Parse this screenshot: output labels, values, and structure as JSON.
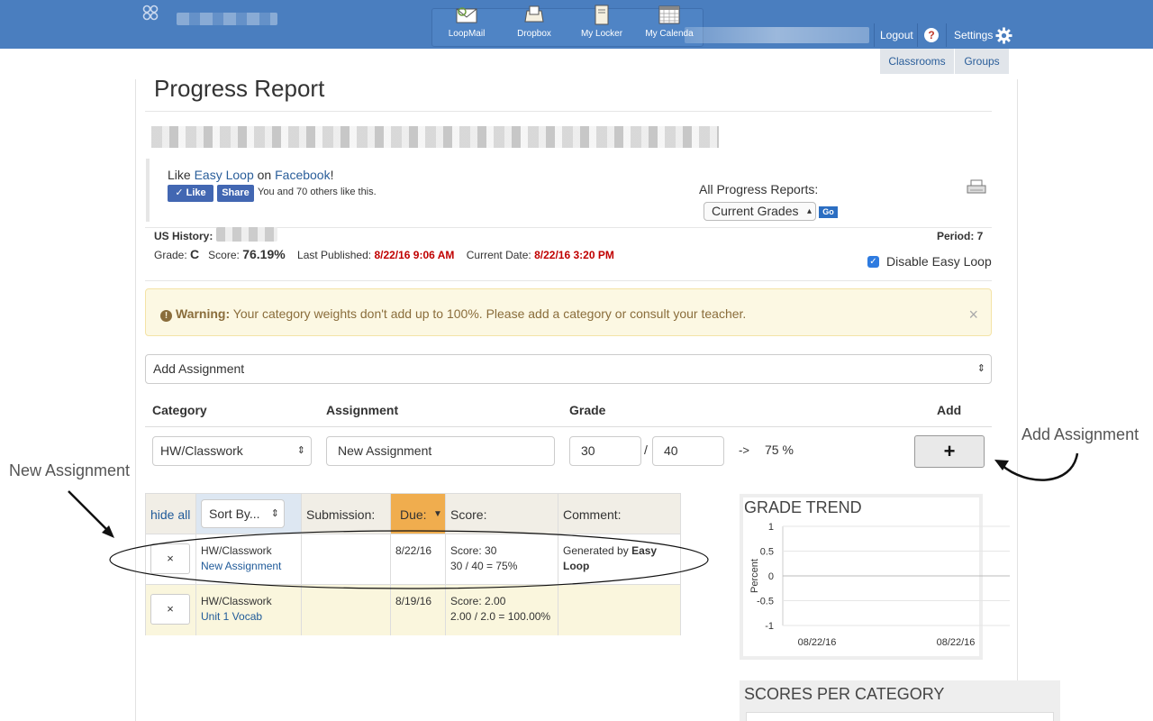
{
  "header": {
    "nav": [
      {
        "label": "LoopMail",
        "icon": "mail-icon"
      },
      {
        "label": "Dropbox",
        "icon": "dropbox-icon"
      },
      {
        "label": "My Locker",
        "icon": "locker-icon"
      },
      {
        "label": "My Calenda",
        "icon": "calendar-icon"
      }
    ],
    "logout": "Logout",
    "help": "?",
    "settings": "Settings",
    "tabs": [
      "Classrooms",
      "Groups"
    ]
  },
  "page": {
    "title": "Progress Report"
  },
  "facebook": {
    "prefix": "Like ",
    "easy_loop": "Easy Loop",
    "middle": " on ",
    "facebook": "Facebook",
    "suffix": "!",
    "like": "Like",
    "share": "Share",
    "count": "You and 70 others like this."
  },
  "reports": {
    "label": "All Progress Reports:",
    "selected": "Current Grades",
    "go": "Go"
  },
  "course": {
    "name": "US History:",
    "period": "Period: 7",
    "grade_label": "Grade:",
    "grade": "C",
    "score_label": "Score:",
    "score": "76.19%",
    "published_label": "Last Published:",
    "published": "8/22/16 9:06 AM",
    "current_label": "Current Date:",
    "current": "8/22/16 3:20 PM",
    "disable": "Disable Easy Loop"
  },
  "warning": {
    "label": "Warning:",
    "text": " Your category weights don't add up to 100%. Please add a category or consult your teacher.",
    "close": "×"
  },
  "add_form": {
    "select": "Add Assignment",
    "headers": {
      "category": "Category",
      "assignment": "Assignment",
      "grade": "Grade",
      "add": "Add"
    },
    "category": "HW/Classwork",
    "assignment": "New Assignment",
    "points": "30",
    "slash": "/",
    "total": "40",
    "arrow": "->",
    "percent": "75 %",
    "plus": "+"
  },
  "table": {
    "hide_all": "hide all",
    "sort": "Sort By...",
    "headers": {
      "submission": "Submission:",
      "due": "Due:",
      "score": "Score:",
      "comment": "Comment:"
    },
    "rows": [
      {
        "x": "×",
        "category": "HW/Classwork",
        "name": "New Assignment",
        "due": "8/22/16",
        "score1": "Score: 30",
        "score2": "30 / 40 = 75%",
        "comment_a": "Generated by ",
        "comment_b": "Easy",
        "comment_c": "Loop"
      },
      {
        "x": "×",
        "category": "HW/Classwork",
        "name": "Unit 1 Vocab",
        "due": "8/19/16",
        "score1": "Score: 2.00",
        "score2": "2.00 / 2.0 = 100.00%",
        "comment_a": "",
        "comment_b": "",
        "comment_c": ""
      }
    ]
  },
  "annotations": {
    "new_assignment": "New Assignment",
    "add_assignment": "Add Assignment"
  },
  "grade_trend": {
    "title": "GRADE TREND",
    "ylabel": "Percent"
  },
  "scores_category": {
    "title": "SCORES PER CATEGORY"
  },
  "chart_data": {
    "type": "line",
    "title": "GRADE TREND",
    "ylabel": "Percent",
    "ylim": [
      -1,
      1
    ],
    "yticks": [
      "1",
      "0.5",
      "0",
      "-0.5",
      "-1"
    ],
    "x": [
      "08/22/16",
      "08/22/16"
    ],
    "series": []
  },
  "colors": {
    "topbar": "#4a7ebf",
    "due_header": "#f0ad4e",
    "warning_bg": "#fcf8e3"
  }
}
